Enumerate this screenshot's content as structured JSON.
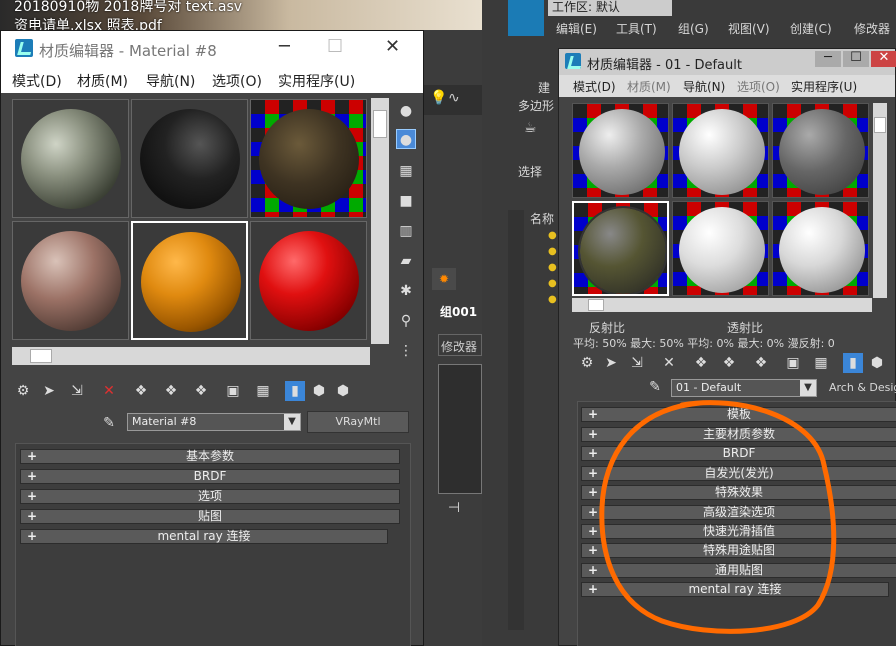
{
  "desktop": {
    "line1": "20180910物  2018牌号对      text.asv",
    "line2": "资电请单.xlsx    照表.pdf"
  },
  "left_window": {
    "title": "材质编辑器 - Material #8",
    "menu": [
      "模式(D)",
      "材质(M)",
      "导航(N)",
      "选项(O)",
      "实用程序(U)"
    ],
    "material_name": "Material #8",
    "material_type": "VRayMtl",
    "rollouts": [
      "基本参数",
      "BRDF",
      "选项",
      "贴图",
      "mental ray 连接"
    ]
  },
  "middle_panel": {
    "group_label": "组001",
    "modifier_label": "修改器"
  },
  "right_app": {
    "workspace": "工作区: 默认",
    "menu": [
      "编辑(E)",
      "工具(T)",
      "组(G)",
      "视图(V)",
      "创建(C)",
      "修改器"
    ],
    "side_labels": [
      "建",
      "多边形",
      "选择",
      "名称"
    ]
  },
  "right_window": {
    "title": "材质编辑器 - 01 - Default",
    "menu": [
      "模式(D)",
      "材质(M)",
      "导航(N)",
      "选项(O)",
      "实用程序(U)"
    ],
    "reflectance_label": "反射比",
    "transmittance_label": "透射比",
    "stats": "平均:   50%  最大:   50%      平均:     0% 最大:     0% 漫反射:   0",
    "material_name": "01 - Default",
    "material_type": "Arch & Design",
    "rollouts": [
      "模板",
      "主要材质参数",
      "BRDF",
      "自发光(发光)",
      "特殊效果",
      "高级渲染选项",
      "快速光滑插值",
      "特殊用途贴图",
      "通用贴图",
      "mental ray 连接"
    ]
  },
  "colors": {
    "annotation": "#ff6a00",
    "active_tool": "#3b86d8"
  }
}
